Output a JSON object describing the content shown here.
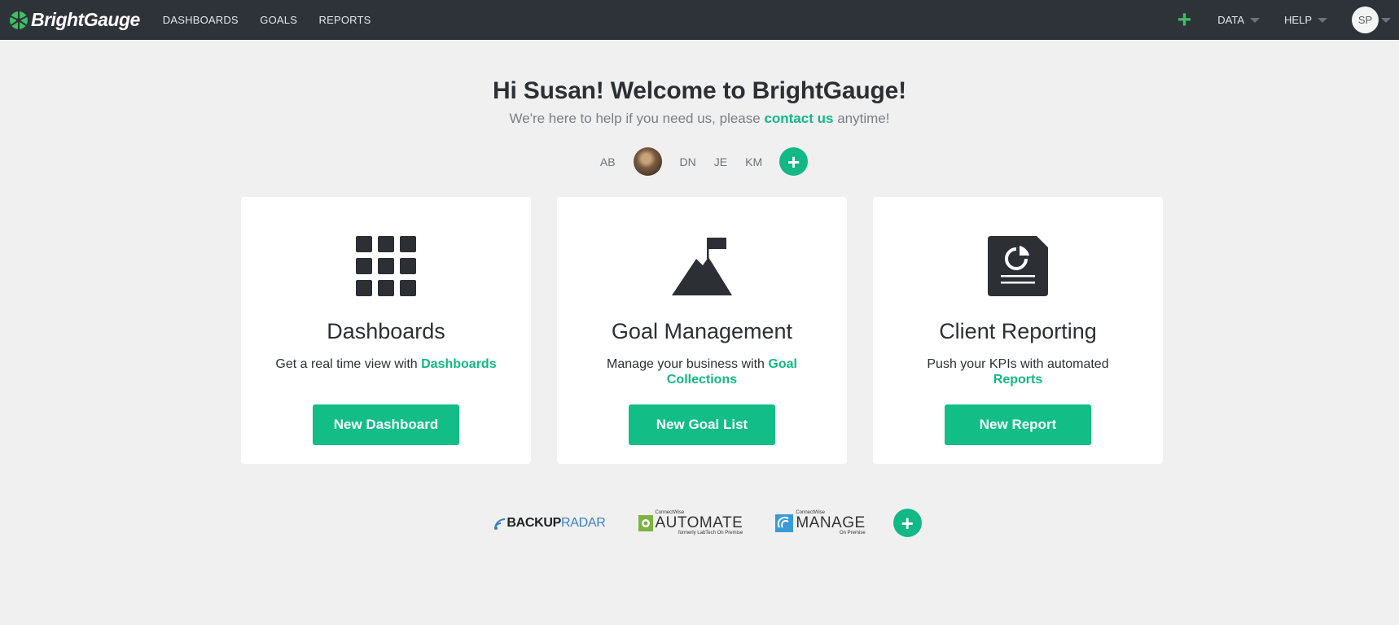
{
  "topbar": {
    "logo_text": "BrightGauge",
    "nav": [
      "DASHBOARDS",
      "GOALS",
      "REPORTS"
    ],
    "add_label": "+",
    "data_label": "DATA",
    "help_label": "HELP",
    "user_initials": "SP"
  },
  "welcome": {
    "title": "Hi Susan! Welcome to BrightGauge!",
    "subtitle_before": "We're here to help if you need us, please ",
    "subtitle_link": "contact us",
    "subtitle_after": " anytime!"
  },
  "users": {
    "initials": [
      "AB",
      "DN",
      "JE",
      "KM"
    ],
    "add_label": "+"
  },
  "cards": [
    {
      "icon": "grid-icon",
      "title": "Dashboards",
      "desc_before": "Get a real time view with ",
      "desc_link": "Dashboards",
      "button": "New Dashboard"
    },
    {
      "icon": "mountain-flag-icon",
      "title": "Goal Management",
      "desc_before": "Manage your business with ",
      "desc_link": "Goal Collections",
      "button": "New Goal List"
    },
    {
      "icon": "report-document-icon",
      "title": "Client Reporting",
      "desc_before": "Push your KPIs with automated ",
      "desc_link": "Reports",
      "button": "New Report"
    }
  ],
  "integrations": {
    "backup_radar": {
      "part1": "BACKUP",
      "part2": "RADAR"
    },
    "automate": {
      "small": "ConnectWise",
      "big": "AUTOMATE",
      "sub": "formerly LabTech On Premise"
    },
    "manage": {
      "small": "ConnectWise",
      "big": "MANAGE",
      "sub": "On Premise"
    },
    "add_label": "+"
  },
  "colors": {
    "topbar": "#2e3239",
    "accent": "#12b886",
    "background": "#f0f0f0"
  }
}
